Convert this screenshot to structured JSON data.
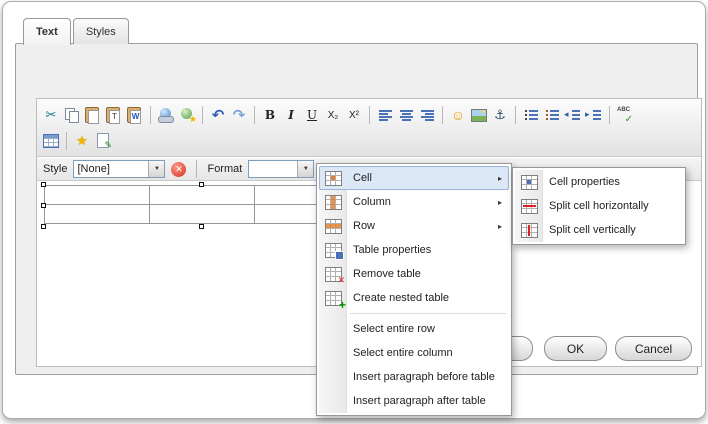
{
  "tabs": {
    "text": "Text",
    "styles": "Styles"
  },
  "toolbar": {
    "row1": [
      "cut",
      "copy",
      "paste",
      "paste-text",
      "paste-word",
      "|",
      "link",
      "browse",
      "|",
      "undo",
      "redo",
      "|",
      "bold",
      "italic",
      "underline",
      "subscript",
      "superscript",
      "|",
      "align-left",
      "align-center",
      "align-right",
      "|",
      "smiley",
      "image",
      "anchor",
      "|",
      "bulleted-list",
      "numbered-list",
      "outdent",
      "indent",
      "|",
      "spellcheck"
    ],
    "row2": [
      "table",
      "|",
      "star",
      "form"
    ]
  },
  "stylebar": {
    "style_label": "Style",
    "style_value": "[None]",
    "format_label": "Format",
    "format_value": ""
  },
  "editor_table": {
    "rows": 2,
    "cols": 3
  },
  "context_menu": {
    "items": [
      {
        "label": "Cell",
        "icon": "cell",
        "submenu": true,
        "highlighted": true
      },
      {
        "label": "Column",
        "icon": "column",
        "submenu": true
      },
      {
        "label": "Row",
        "icon": "row",
        "submenu": true
      },
      {
        "label": "Table properties",
        "icon": "table-properties"
      },
      {
        "label": "Remove table",
        "icon": "remove-table"
      },
      {
        "label": "Create nested table",
        "icon": "nested-table"
      },
      {
        "separator": true
      },
      {
        "label": "Select entire row"
      },
      {
        "label": "Select entire column"
      },
      {
        "label": "Insert paragraph before table"
      },
      {
        "label": "Insert paragraph after table"
      }
    ]
  },
  "submenu": {
    "items": [
      {
        "label": "Cell properties",
        "icon": "cell-properties"
      },
      {
        "label": "Split cell horizontally",
        "icon": "split-horizontal"
      },
      {
        "label": "Split cell vertically",
        "icon": "split-vertical"
      }
    ]
  },
  "footer": {
    "ok": "OK",
    "cancel": "Cancel"
  }
}
